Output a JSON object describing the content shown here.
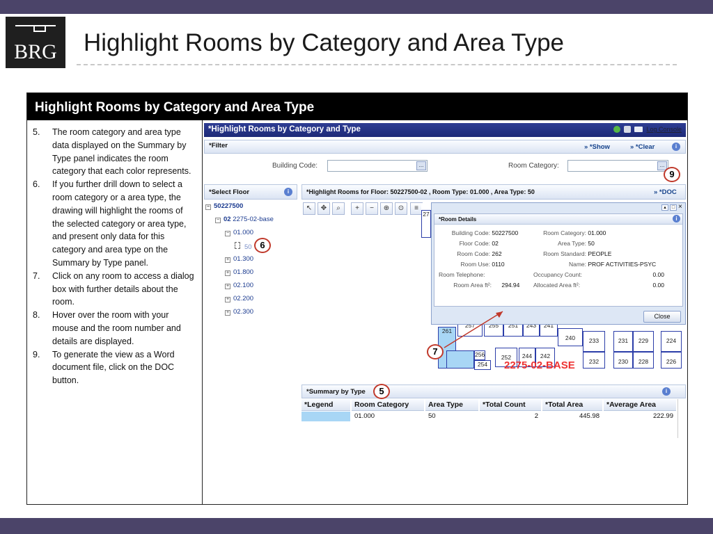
{
  "slide": {
    "title": "Highlight Rooms by Category and Area Type",
    "logo_text": "BRG",
    "box_header": "Highlight Rooms by Category and Area Type"
  },
  "steps": [
    {
      "num": "5.",
      "text": "The room category and area type data displayed on the Summary by Type panel indicates the room category that each color represents."
    },
    {
      "num": "6.",
      "text": "If you further drill down to select a room category or a area type, the drawing will highlight the rooms of the selected category or area type, and present only data for this category and area type on the Summary by Type panel."
    },
    {
      "num": "7.",
      "text": "Click on any room to access a dialog box with further details about the room."
    },
    {
      "num": "8.",
      "text": "Hover over the room with your mouse and the room number and details are displayed."
    },
    {
      "num": "9.",
      "text": "To generate the view as a Word document file, click on the DOC button."
    }
  ],
  "app": {
    "title": "*Highlight Rooms by Category and Type",
    "log_console": "Log Console",
    "filter": {
      "title": "*Filter",
      "show": "» *Show",
      "clear": "» *Clear",
      "building_code_label": "Building Code:",
      "room_category_label": "Room Category:",
      "dots": "..."
    },
    "select_floor": {
      "title": "*Select Floor",
      "tree": [
        {
          "label": "50227500",
          "level": 0,
          "toggle": "−"
        },
        {
          "label": "02",
          "sub": "2275-02-base",
          "level": 1,
          "toggle": "−"
        },
        {
          "label": "01.000",
          "level": 2,
          "toggle": "−"
        },
        {
          "label": "50",
          "level": 3,
          "toggle": ""
        },
        {
          "label": "01.300",
          "level": 2,
          "toggle": "+"
        },
        {
          "label": "01.800",
          "level": 2,
          "toggle": "+"
        },
        {
          "label": "02.100",
          "level": 2,
          "toggle": "+"
        },
        {
          "label": "02.200",
          "level": 2,
          "toggle": "+"
        },
        {
          "label": "02.300",
          "level": 2,
          "toggle": "+"
        }
      ]
    },
    "drawing": {
      "title": "*Highlight Rooms for Floor: 50227500-02 , Room Type: 01.000 , Area Type: 50",
      "doc_button": "» *DOC",
      "base_label": "2275-02-BASE",
      "rooms": [
        "261",
        "257",
        "255",
        "251",
        "243",
        "241",
        "240",
        "233",
        "231",
        "229",
        "224",
        "256",
        "252",
        "254",
        "244",
        "242",
        "232",
        "230",
        "228",
        "226",
        "27"
      ]
    },
    "room_details": {
      "title": "*Room Details",
      "rows_left": [
        {
          "k": "Building Code:",
          "v": "50227500"
        },
        {
          "k": "Floor Code:",
          "v": "02"
        },
        {
          "k": "Room Code:",
          "v": "262"
        },
        {
          "k": "Room Use:",
          "v": "0110"
        },
        {
          "k": "Room Telephone:",
          "v": ""
        },
        {
          "k": "Room Area ft²:",
          "v": "294.94"
        }
      ],
      "rows_right": [
        {
          "k": "Room Category:",
          "v": "01.000"
        },
        {
          "k": "Area Type:",
          "v": "50"
        },
        {
          "k": "Room Standard:",
          "v": "PEOPLE"
        },
        {
          "k": "Name:",
          "v": "PROF ACTIVITIES-PSYC"
        },
        {
          "k": "Occupancy Count:",
          "v": "0.00"
        },
        {
          "k": "Allocated Area ft²:",
          "v": "0.00"
        }
      ],
      "close": "Close"
    },
    "summary": {
      "title": "*Summary by Type",
      "columns": [
        "*Legend",
        "Room Category",
        "Area Type",
        "*Total Count",
        "*Total Area",
        "*Average Area"
      ],
      "row": {
        "legend_color": "#a8d6f5",
        "room_category": "01.000",
        "area_type": "50",
        "total_count": "2",
        "total_area": "445.98",
        "average_area": "222.99"
      }
    }
  },
  "callouts": {
    "c5": "5",
    "c6": "6",
    "c7": "7",
    "c9": "9"
  }
}
